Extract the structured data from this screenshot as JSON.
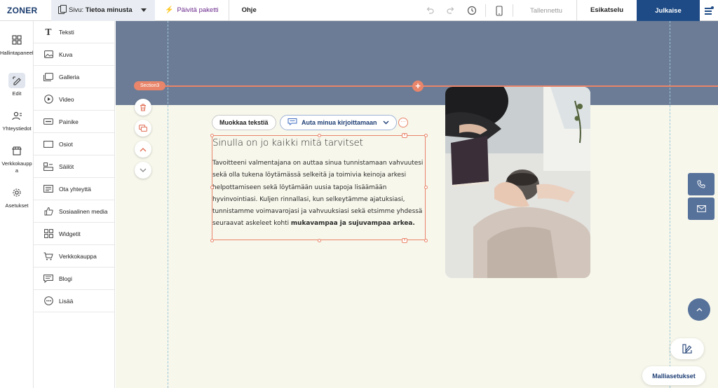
{
  "app": {
    "logo": "ZONER"
  },
  "topbar": {
    "page_label": "Sivu:",
    "page_name": "Tietoa minusta",
    "upgrade": "Päivitä paketti",
    "help": "Ohje",
    "saved": "Tallennettu",
    "preview": "Esikatselu",
    "publish": "Julkaise"
  },
  "rail": [
    {
      "label": "Hallintapaneeli",
      "icon": "dashboard-icon"
    },
    {
      "label": "Edit",
      "icon": "edit-icon",
      "active": true
    },
    {
      "label": "Yhteystiedot",
      "icon": "contacts-icon"
    },
    {
      "label": "Verkkokauppa",
      "icon": "store-icon"
    },
    {
      "label": "Asetukset",
      "icon": "settings-icon"
    }
  ],
  "panel": [
    {
      "label": "Teksti",
      "icon": "text-icon"
    },
    {
      "label": "Kuva",
      "icon": "image-icon"
    },
    {
      "label": "Galleria",
      "icon": "gallery-icon"
    },
    {
      "label": "Video",
      "icon": "video-icon"
    },
    {
      "label": "Painike",
      "icon": "button-icon"
    },
    {
      "label": "Osiot",
      "icon": "sections-icon"
    },
    {
      "label": "Säilöt",
      "icon": "containers-icon"
    },
    {
      "label": "Ota yhteyttä",
      "icon": "contact-form-icon"
    },
    {
      "label": "Sosiaalinen media",
      "icon": "social-icon"
    },
    {
      "label": "Widgetit",
      "icon": "widgets-icon"
    },
    {
      "label": "Verkkokauppa",
      "icon": "cart-icon"
    },
    {
      "label": "Blogi",
      "icon": "blog-icon"
    },
    {
      "label": "Lisää",
      "icon": "more-icon"
    }
  ],
  "canvas": {
    "section_label": "Section3",
    "edit_text_button": "Muokkaa tekstiä",
    "ai_button": "Auta minua kirjoittamaan",
    "heading": "Sinulla on jo kaikki mitä tarvitset",
    "body_text": "Tavoitteeni valmentajana on auttaa sinua tunnistamaan vahvuutesi sekä olla tukena löytämässä selkeitä ja toimivia keinoja arkesi helpottamiseen sekä löytämään uusia tapoja lisäämään hyvinvointiasi. Kuljen rinnallasi, kun selkeytämme ajatuksiasi, tunnistamme voimavarojasi ja vahvuuksiasi sekä etsimme yhdessä seuraavat askeleet kohti ",
    "body_bold": "mukavampaa ja sujuvampaa arkea.",
    "templates_button": "Malliasetukset"
  },
  "colors": {
    "accent": "#e9856a",
    "brand": "#1e4b86",
    "header_band": "#6c7c96",
    "canvas_bg": "#f7f7ec"
  }
}
